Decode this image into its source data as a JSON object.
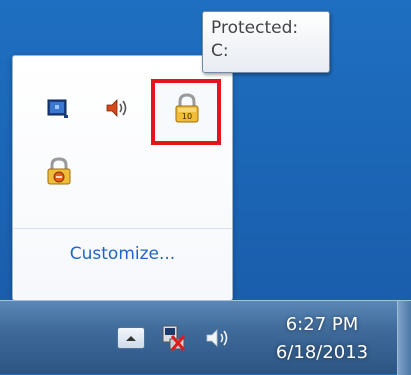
{
  "tooltip": {
    "line1": "Protected:",
    "line2": "C:"
  },
  "tray_popup": {
    "icons": [
      {
        "name": "network-adapter-icon",
        "label": ""
      },
      {
        "name": "volume-icon",
        "label": ""
      },
      {
        "name": "padlock-10-icon",
        "label": "10"
      },
      {
        "name": "padlock-shield-icon",
        "label": ""
      }
    ],
    "customize_label": "Customize..."
  },
  "taskbar": {
    "clock": {
      "time": "6:27 PM",
      "date": "6/18/2013"
    },
    "icons": [
      "show-hidden-icons-button",
      "network-disconnected-icon",
      "volume-icon"
    ]
  },
  "colors": {
    "highlight": "#e3141a",
    "link": "#1f66c4",
    "desktop": "#1b63b3"
  }
}
